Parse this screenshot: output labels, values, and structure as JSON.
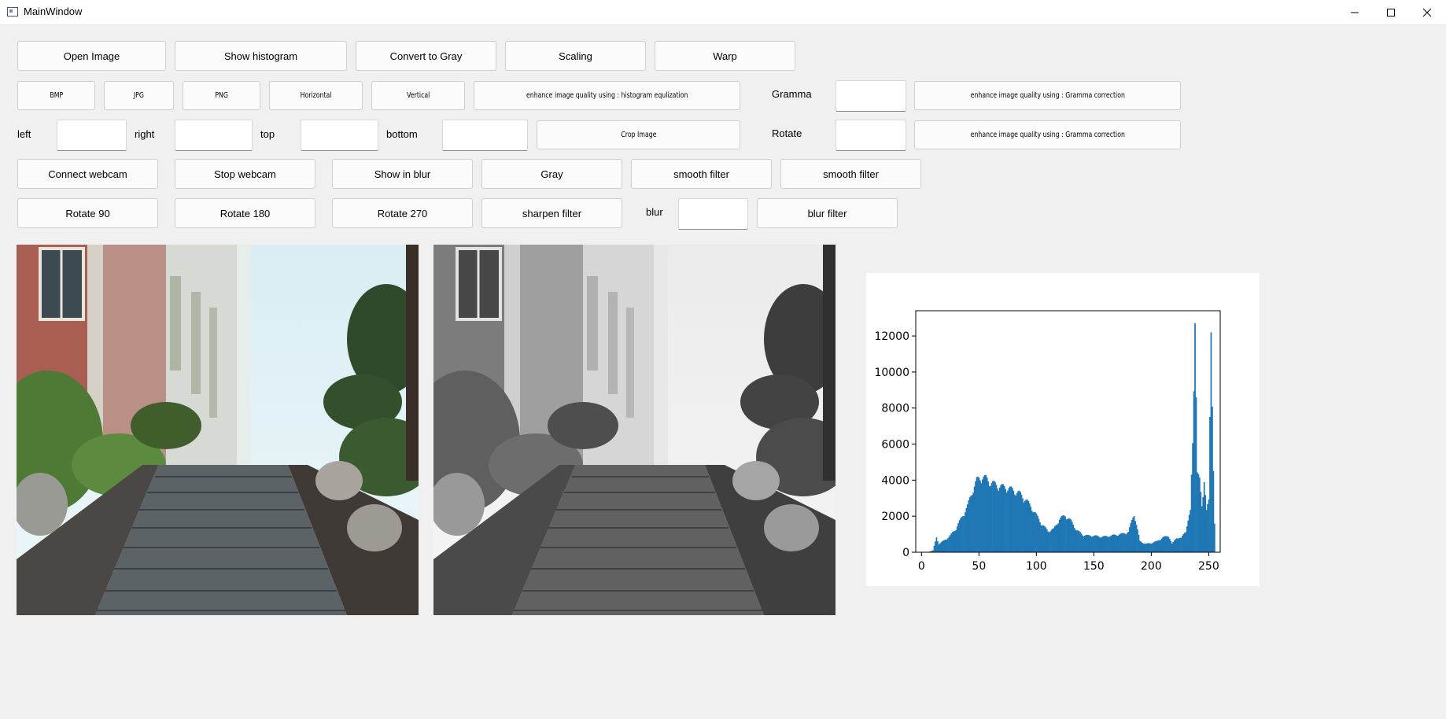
{
  "window": {
    "title": "MainWindow"
  },
  "row1": {
    "open_image": "Open Image",
    "show_histogram": "Show histogram",
    "convert_gray": "Convert to Gray",
    "scaling": "Scaling",
    "warp": "Warp"
  },
  "row2": {
    "bmp": "BMP",
    "jpg": "JPG",
    "png": "PNG",
    "horizontal": "Horizontal",
    "vertical": "Vertical",
    "hist_eq": "enhance image quality using : histogram equlization",
    "gamma_label": "Gramma",
    "gamma_value": "",
    "gamma_btn": "enhance image quality using : Gramma correction"
  },
  "row3": {
    "left_label": "left",
    "left_value": "",
    "right_label": "right",
    "right_value": "",
    "top_label": "top",
    "top_value": "",
    "bottom_label": "bottom",
    "bottom_value": "",
    "crop_btn": "Crop Image",
    "rotate_label": "Rotate",
    "rotate_value": "",
    "rotate_btn": "enhance image quality using : Gramma correction"
  },
  "row4": {
    "connect_webcam": "Connect webcam",
    "stop_webcam": "Stop webcam",
    "show_blur": "Show in blur",
    "gray": "Gray",
    "smooth1": "smooth filter",
    "smooth2": "smooth filter"
  },
  "row5": {
    "rotate90": "Rotate 90",
    "rotate180": "Rotate 180",
    "rotate270": "Rotate 270",
    "sharpen": "sharpen filter",
    "blur_label": "blur",
    "blur_value": "",
    "blur_filter": "blur filter"
  },
  "chart_data": {
    "type": "bar",
    "title": "",
    "xlabel": "",
    "ylabel": "",
    "xlim": [
      -5,
      260
    ],
    "ylim": [
      0,
      13400
    ],
    "xticks": [
      "0",
      "50",
      "100",
      "150",
      "200",
      "250"
    ],
    "yticks": [
      "0",
      "2000",
      "4000",
      "6000",
      "8000",
      "10000",
      "12000"
    ],
    "bar_color": "#1f77b4",
    "points": [
      [
        0,
        0
      ],
      [
        5,
        0
      ],
      [
        10,
        100
      ],
      [
        13,
        800
      ],
      [
        15,
        450
      ],
      [
        20,
        650
      ],
      [
        25,
        900
      ],
      [
        30,
        1300
      ],
      [
        35,
        1900
      ],
      [
        40,
        2500
      ],
      [
        44,
        3300
      ],
      [
        48,
        3900
      ],
      [
        52,
        4100
      ],
      [
        56,
        4000
      ],
      [
        60,
        3800
      ],
      [
        65,
        3650
      ],
      [
        70,
        3550
      ],
      [
        75,
        3500
      ],
      [
        80,
        3350
      ],
      [
        85,
        3200
      ],
      [
        90,
        2900
      ],
      [
        95,
        2500
      ],
      [
        100,
        2000
      ],
      [
        105,
        1500
      ],
      [
        110,
        1150
      ],
      [
        115,
        1250
      ],
      [
        120,
        1800
      ],
      [
        125,
        2000
      ],
      [
        130,
        1700
      ],
      [
        135,
        1200
      ],
      [
        140,
        950
      ],
      [
        145,
        900
      ],
      [
        150,
        900
      ],
      [
        155,
        850
      ],
      [
        160,
        850
      ],
      [
        165,
        900
      ],
      [
        170,
        950
      ],
      [
        175,
        1000
      ],
      [
        180,
        1100
      ],
      [
        185,
        2100
      ],
      [
        188,
        1200
      ],
      [
        190,
        600
      ],
      [
        195,
        450
      ],
      [
        200,
        500
      ],
      [
        205,
        600
      ],
      [
        210,
        800
      ],
      [
        215,
        900
      ],
      [
        218,
        450
      ],
      [
        222,
        800
      ],
      [
        226,
        750
      ],
      [
        230,
        1200
      ],
      [
        234,
        2200
      ],
      [
        236,
        6000
      ],
      [
        238,
        12700
      ],
      [
        240,
        4200
      ],
      [
        242,
        3900
      ],
      [
        244,
        2600
      ],
      [
        246,
        3900
      ],
      [
        248,
        2200
      ],
      [
        250,
        2800
      ],
      [
        252,
        12200
      ],
      [
        254,
        4400
      ],
      [
        255,
        1500
      ]
    ]
  }
}
